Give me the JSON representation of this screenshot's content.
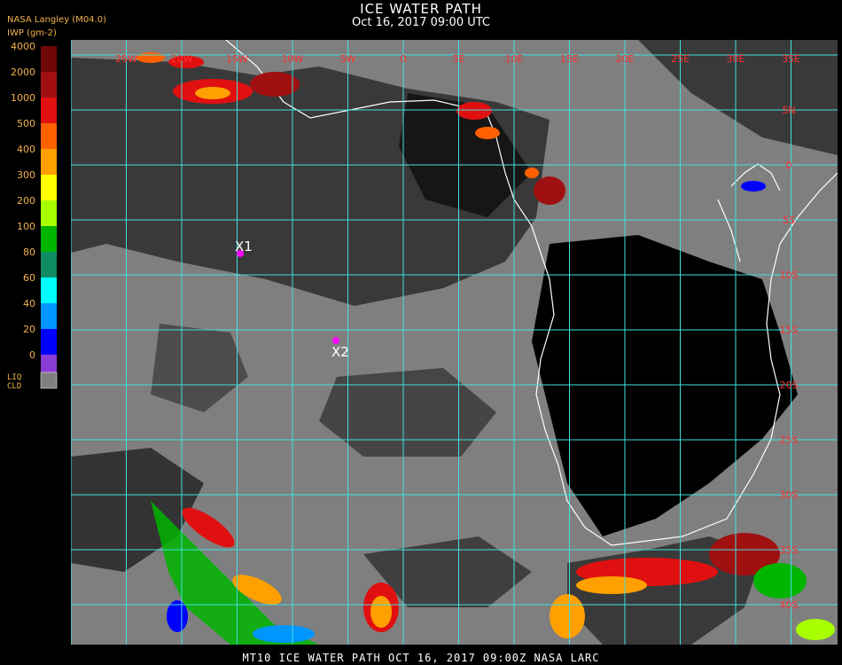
{
  "header": {
    "title": "ICE WATER PATH",
    "subtitle": "Oct 16, 2017 09:00 UTC",
    "credit": "NASA Langley (M04.0)",
    "units": "IWP (gm-2)"
  },
  "legend": {
    "bins": [
      {
        "label": "4000",
        "color": "#6e0808"
      },
      {
        "label": "2000",
        "color": "#a01010"
      },
      {
        "label": "1000",
        "color": "#e01010"
      },
      {
        "label": "500",
        "color": "#ff6000"
      },
      {
        "label": "400",
        "color": "#ffa000"
      },
      {
        "label": "300",
        "color": "#ffff00"
      },
      {
        "label": "200",
        "color": "#a8ff00"
      },
      {
        "label": "100",
        "color": "#00b400"
      },
      {
        "label": "80",
        "color": "#108c64"
      },
      {
        "label": "60",
        "color": "#00ffff"
      },
      {
        "label": "40",
        "color": "#0096ff"
      },
      {
        "label": "20",
        "color": "#0000ff"
      },
      {
        "label": "0",
        "color": "#8c3cd6"
      }
    ],
    "liq_label_1": "LIQ",
    "liq_label_2": "CLD",
    "liq_color": "#808080"
  },
  "map": {
    "lon_labels": [
      "25W",
      "20W",
      "15W",
      "10W",
      "5W",
      "0",
      "5E",
      "10E",
      "15E",
      "20E",
      "25E",
      "30E",
      "35E"
    ],
    "lat_labels": [
      "5N",
      "0",
      "5S",
      "10S",
      "15S",
      "20S",
      "25S",
      "30S",
      "35S",
      "40S"
    ],
    "grid_color": "#40e0e0",
    "label_color": "#ff3030",
    "markers": [
      {
        "label": "X1",
        "color": "#ff00ff"
      },
      {
        "label": "X2",
        "color": "#ff00ff"
      }
    ]
  },
  "footer": "MT10  ICE WATER PATH   OCT 16, 2017 09:00Z   NASA LARC"
}
